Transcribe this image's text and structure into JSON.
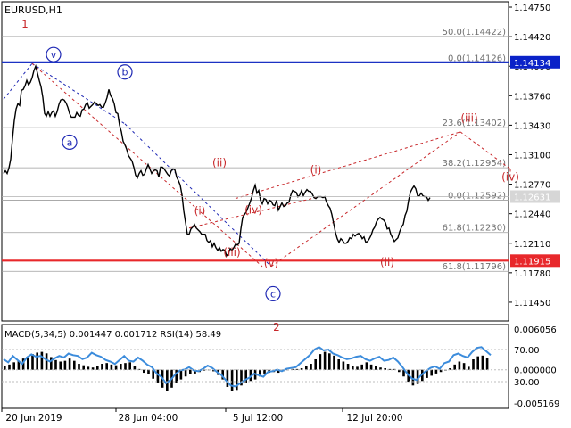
{
  "symbol_label": "EURUSD,H1",
  "indicator_label": "MACD(5,34,5) 0.001447 0.001712 RSI(14) 58.49",
  "chart_data": [
    {
      "type": "line",
      "title": "EURUSD,H1",
      "ylim": [
        1.1124,
        1.1481
      ],
      "y_ticks": [
        "1.14750",
        "1.14420",
        "1.14090",
        "1.13760",
        "1.13430",
        "1.13100",
        "1.12770",
        "1.12440",
        "1.12110",
        "1.11780",
        "1.11450"
      ],
      "y_tick_values": [
        1.1475,
        1.1442,
        1.1409,
        1.1376,
        1.1343,
        1.131,
        1.1277,
        1.1244,
        1.1211,
        1.1178,
        1.1145
      ],
      "x_tick_labels": [
        "20 Jun 2019",
        "28 Jun 04:00",
        "5 Jul 12:00",
        "12 Jul 20:00"
      ],
      "x": [
        0,
        1,
        2,
        3,
        4,
        5,
        6,
        7,
        8,
        9,
        10,
        11,
        12,
        13,
        14,
        15,
        16,
        17,
        18,
        19,
        20,
        21,
        22,
        23,
        24,
        25,
        26,
        27,
        28,
        29,
        30,
        31,
        32,
        33,
        34,
        35,
        36,
        37,
        38,
        39,
        40,
        41,
        42,
        43,
        44,
        45,
        46,
        47,
        48,
        49,
        50,
        51,
        52,
        53,
        54,
        55,
        56,
        57,
        58,
        59,
        60,
        61,
        62,
        63,
        64,
        65,
        66,
        67,
        68,
        69,
        70,
        71,
        72,
        73,
        74,
        75,
        76,
        77,
        78,
        79,
        80,
        81,
        82,
        83,
        84,
        85,
        86,
        87,
        88,
        89,
        90,
        91,
        92,
        93,
        94,
        95,
        96,
        97,
        98,
        99,
        100,
        101,
        102,
        103,
        104,
        105,
        106,
        107,
        108,
        109,
        110,
        111,
        112,
        113,
        114,
        115,
        116,
        117,
        118,
        119,
        120,
        121,
        122,
        123,
        124,
        125,
        126,
        127,
        128,
        129,
        130,
        131,
        132,
        133,
        134,
        135,
        136,
        137,
        138,
        139,
        140,
        141,
        142,
        143,
        144,
        145,
        146,
        147,
        148,
        149,
        150,
        151,
        152,
        153,
        154,
        155,
        156,
        157,
        158,
        159,
        160,
        161,
        162,
        163,
        164,
        165,
        166,
        167,
        168,
        169,
        170,
        171,
        172,
        173,
        174,
        175,
        176,
        177,
        178,
        179,
        180,
        181,
        182,
        183,
        184,
        185,
        186,
        187,
        188,
        189,
        190,
        191,
        192,
        193,
        194,
        195,
        196,
        197,
        198,
        199,
        200,
        201,
        202,
        203,
        204,
        205,
        206,
        207,
        208,
        209,
        210,
        211,
        212,
        213,
        214,
        215,
        216,
        217,
        218,
        219,
        220,
        221,
        222,
        223,
        224,
        225,
        226,
        227,
        228,
        229,
        230,
        231,
        232,
        233,
        234,
        235,
        236,
        237,
        238,
        239,
        240,
        241,
        242,
        243,
        244,
        245,
        246
      ],
      "price": [
        1.1289,
        1.1292,
        1.1289,
        1.1295,
        1.1305,
        1.1328,
        1.1348,
        1.1361,
        1.1367,
        1.1365,
        1.1382,
        1.1383,
        1.1387,
        1.1393,
        1.1388,
        1.1391,
        1.1396,
        1.1404,
        1.1409,
        1.1401,
        1.1393,
        1.1386,
        1.1374,
        1.1356,
        1.1353,
        1.1358,
        1.1353,
        1.1357,
        1.1359,
        1.1353,
        1.1358,
        1.1366,
        1.1371,
        1.1372,
        1.1371,
        1.1368,
        1.1363,
        1.1356,
        1.1352,
        1.1352,
        1.1352,
        1.1357,
        1.1354,
        1.1353,
        1.136,
        1.1361,
        1.1366,
        1.1368,
        1.1362,
        1.1364,
        1.1366,
        1.1369,
        1.1367,
        1.1365,
        1.1366,
        1.1363,
        1.1363,
        1.1368,
        1.1374,
        1.1383,
        1.1376,
        1.1373,
        1.1367,
        1.1357,
        1.1356,
        1.1343,
        1.1336,
        1.1325,
        1.1321,
        1.1316,
        1.1309,
        1.1306,
        1.1303,
        1.1296,
        1.1287,
        1.1284,
        1.1289,
        1.1292,
        1.1287,
        1.1288,
        1.1294,
        1.1299,
        1.1294,
        1.1289,
        1.1292,
        1.1293,
        1.1292,
        1.1285,
        1.1296,
        1.1296,
        1.1294,
        1.1291,
        1.1288,
        1.1286,
        1.1292,
        1.1294,
        1.1293,
        1.1285,
        1.1281,
        1.1276,
        1.1265,
        1.1247,
        1.1234,
        1.1221,
        1.1221,
        1.1227,
        1.1229,
        1.1232,
        1.1228,
        1.1226,
        1.1224,
        1.1221,
        1.1221,
        1.1221,
        1.1214,
        1.1212,
        1.1214,
        1.1207,
        1.1211,
        1.1206,
        1.1203,
        1.1206,
        1.1202,
        1.1204,
        1.1203,
        1.1197,
        1.1199,
        1.1205,
        1.1203,
        1.1206,
        1.121,
        1.1209,
        1.1211,
        1.1227,
        1.124,
        1.1243,
        1.1246,
        1.1251,
        1.1256,
        1.1262,
        1.127,
        1.1276,
        1.1267,
        1.127,
        1.1259,
        1.1255,
        1.1261,
        1.126,
        1.1255,
        1.1259,
        1.1258,
        1.1254,
        1.1253,
        1.1259,
        1.1248,
        1.1252,
        1.1256,
        1.1252,
        1.1253,
        1.1256,
        1.1257,
        1.1265,
        1.127,
        1.1269,
        1.1268,
        1.1263,
        1.1265,
        1.127,
        1.1264,
        1.1268,
        1.1271,
        1.1269,
        1.1269,
        1.1266,
        1.1262,
        1.1261,
        1.1263,
        1.1263,
        1.1263,
        1.1262,
        1.1263,
        1.1257,
        1.1253,
        1.125,
        1.1243,
        1.1233,
        1.1223,
        1.1216,
        1.1212,
        1.1216,
        1.1214,
        1.1211,
        1.1211,
        1.1213,
        1.1217,
        1.1216,
        1.1221,
        1.1219,
        1.1221,
        1.1222,
        1.122,
        1.1216,
        1.1218,
        1.1212,
        1.1213,
        1.1216,
        1.122,
        1.1226,
        1.1229,
        1.1235,
        1.1238,
        1.124,
        1.1238,
        1.1237,
        1.1234,
        1.1227,
        1.1228,
        1.1221,
        1.1217,
        1.1213,
        1.1215,
        1.1217,
        1.1224,
        1.1229,
        1.1232,
        1.1242,
        1.1247,
        1.1259,
        1.1268,
        1.1272,
        1.1275,
        1.1272,
        1.1264,
        1.1264,
        1.1267,
        1.1264,
        1.1263,
        1.1263,
        1.1259,
        1.1262
      ],
      "current_price": 1.12631,
      "horizontal_levels": [
        {
          "value": 1.14134,
          "label": "1.14134",
          "color": "#0a22c8"
        },
        {
          "value": 1.11915,
          "label": "1.11915",
          "color": "#e8282b"
        }
      ],
      "fibonacci_levels": [
        {
          "label": "50.0(1.14422)",
          "value": 1.14422
        },
        {
          "label": "0.0(1.14126)",
          "value": 1.14126
        },
        {
          "label": "23.6(1.13402)",
          "value": 1.13402
        },
        {
          "label": "38.2(1.12954)",
          "value": 1.12954
        },
        {
          "label": "0.0(1.12592)",
          "value": 1.12592
        },
        {
          "label": "61.8(1.12230)",
          "value": 1.1223
        },
        {
          "label": "61.8(1.11796)",
          "value": 1.11796
        }
      ],
      "wave_labels_red": [
        "1",
        "(i)",
        "(ii)",
        "(iii)",
        "(iv)",
        "(v)",
        "2",
        "(i)",
        "(ii)",
        "(iii)",
        "(iv)"
      ],
      "wave_labels_blue_circled": [
        "v",
        "a",
        "b",
        "c"
      ],
      "colors": {
        "price": "#000000",
        "wave_red": "#c8282b",
        "wave_blue": "#1e28b4",
        "fib": "#bdbdbd"
      }
    },
    {
      "type": "line",
      "title": "MACD(5,34,5) 0.001447 0.001712 RSI(14) 58.49",
      "ylim": [
        -0.005169,
        0.006056
      ],
      "y_ticks": [
        "0.006056",
        "70.00",
        "0.000000",
        "30.00",
        "-0.005169"
      ],
      "series": [
        {
          "name": "MACD",
          "values": [
            0.0005,
            0.0007,
            0.001,
            0.0012,
            0.0015,
            0.0018,
            0.0021,
            0.0023,
            0.0024,
            0.0022,
            0.0017,
            0.0013,
            0.0011,
            0.0012,
            0.0015,
            0.0012,
            0.0008,
            0.0006,
            0.0004,
            0.0003,
            0.0005,
            0.0008,
            0.0009,
            0.0007,
            0.0006,
            0.0008,
            0.0009,
            0.001,
            0.0005,
            0.0001,
            -0.0004,
            -0.0006,
            -0.0012,
            -0.0017,
            -0.0024,
            -0.0028,
            -0.0024,
            -0.0018,
            -0.0013,
            -0.0009,
            -0.0006,
            -0.0005,
            -0.0003,
            -0.0001,
            0.0,
            -0.0002,
            -0.0007,
            -0.0013,
            -0.0023,
            -0.0028,
            -0.0027,
            -0.0021,
            -0.0018,
            -0.0015,
            -0.0013,
            -0.0009,
            -0.0005,
            -0.0004,
            -0.0003,
            -0.0004,
            -0.0002,
            0.0,
            0.0001,
            0.0001,
            0.0002,
            0.0005,
            0.0008,
            0.0014,
            0.0021,
            0.0024,
            0.0022,
            0.0019,
            0.0014,
            0.0011,
            0.0008,
            0.0005,
            0.0004,
            0.0007,
            0.001,
            0.0007,
            0.0005,
            0.0003,
            0.0002,
            0.0001,
            0.0001,
            -0.0003,
            -0.0009,
            -0.0016,
            -0.0021,
            -0.0019,
            -0.0015,
            -0.0011,
            -0.0008,
            -0.0005,
            -0.0003,
            -0.0001,
            0.0002,
            0.0007,
            0.0011,
            0.0009,
            0.0004,
            0.0014,
            0.0018,
            0.0019,
            0.0016
          ]
        },
        {
          "name": "RSI",
          "values": [
            58,
            54,
            62,
            57,
            52,
            60,
            64,
            61,
            62,
            58,
            55,
            59,
            62,
            60,
            65,
            63,
            62,
            58,
            60,
            66,
            63,
            61,
            57,
            55,
            52,
            57,
            62,
            56,
            55,
            60,
            56,
            51,
            48,
            40,
            36,
            28,
            32,
            39,
            44,
            45,
            48,
            44,
            43,
            46,
            50,
            47,
            42,
            38,
            31,
            25,
            24,
            28,
            32,
            35,
            40,
            38,
            36,
            42,
            43,
            45,
            43,
            46,
            47,
            48,
            53,
            58,
            63,
            70,
            73,
            69,
            70,
            65,
            63,
            60,
            58,
            59,
            61,
            62,
            58,
            56,
            59,
            61,
            56,
            57,
            60,
            55,
            48,
            40,
            34,
            32,
            38,
            43,
            47,
            49,
            46,
            53,
            55,
            63,
            65,
            62,
            60,
            67,
            72,
            73,
            68,
            63
          ]
        }
      ]
    }
  ]
}
